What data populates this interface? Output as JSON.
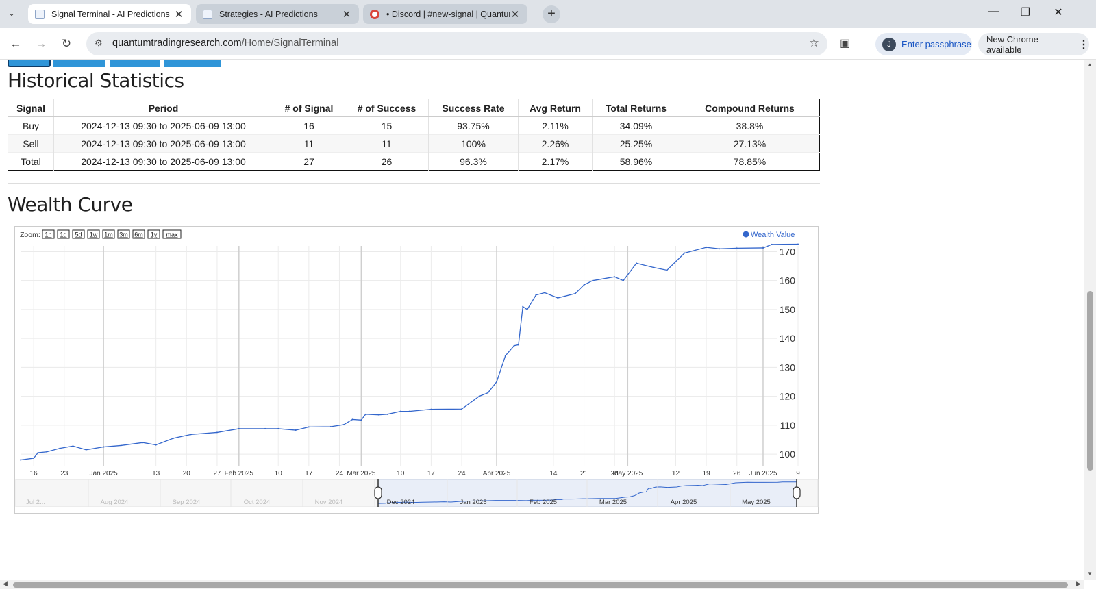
{
  "browser": {
    "tabs": [
      {
        "title": "Signal Terminal - AI Predictions",
        "active": true
      },
      {
        "title": "Strategies - AI Predictions",
        "active": false
      },
      {
        "title": "• Discord | #new-signal | Quantum",
        "active": false
      }
    ],
    "url_host": "quantumtradingresearch.com",
    "url_path": "/Home/SignalTerminal",
    "profile_initial": "J",
    "passphrase_label": "Enter passphrase",
    "update_label": "New Chrome available"
  },
  "page": {
    "stats_title": "Historical Statistics",
    "wealth_title": "Wealth Curve",
    "table": {
      "headers": [
        "Signal",
        "Period",
        "# of Signal",
        "# of Success",
        "Success Rate",
        "Avg Return",
        "Total Returns",
        "Compound Returns"
      ],
      "rows": [
        [
          "Buy",
          "2024-12-13 09:30 to 2025-06-09 13:00",
          "16",
          "15",
          "93.75%",
          "2.11%",
          "34.09%",
          "38.8%"
        ],
        [
          "Sell",
          "2024-12-13 09:30 to 2025-06-09 13:00",
          "11",
          "11",
          "100%",
          "2.26%",
          "25.25%",
          "27.13%"
        ],
        [
          "Total",
          "2024-12-13 09:30 to 2025-06-09 13:00",
          "27",
          "26",
          "96.3%",
          "2.17%",
          "58.96%",
          "78.85%"
        ]
      ]
    }
  },
  "chart_data": {
    "type": "line",
    "zoom_label": "Zoom:",
    "zoom_options": [
      "1h",
      "1d",
      "5d",
      "1w",
      "1m",
      "3m",
      "6m",
      "1y",
      "max"
    ],
    "legend": "Wealth Value",
    "legend_position": "top-right",
    "series_color": "#3366cc",
    "ylim": [
      96,
      172
    ],
    "y_ticks": [
      100,
      110,
      120,
      130,
      140,
      150,
      160,
      170
    ],
    "x_start": "2024-12-13",
    "x_end": "2025-06-09",
    "x_ticks": [
      {
        "date": "2024-12-16",
        "label": "16"
      },
      {
        "date": "2024-12-23",
        "label": "23"
      },
      {
        "date": "2025-01-01",
        "label": "Jan 2025"
      },
      {
        "date": "2025-01-13",
        "label": "13"
      },
      {
        "date": "2025-01-20",
        "label": "20"
      },
      {
        "date": "2025-01-27",
        "label": "27"
      },
      {
        "date": "2025-02-01",
        "label": "Feb 2025"
      },
      {
        "date": "2025-02-10",
        "label": "10"
      },
      {
        "date": "2025-02-17",
        "label": "17"
      },
      {
        "date": "2025-02-24",
        "label": "24"
      },
      {
        "date": "2025-03-01",
        "label": "Mar 2025"
      },
      {
        "date": "2025-03-10",
        "label": "10"
      },
      {
        "date": "2025-03-17",
        "label": "17"
      },
      {
        "date": "2025-03-24",
        "label": "24"
      },
      {
        "date": "2025-04-01",
        "label": "Apr 2025"
      },
      {
        "date": "2025-04-14",
        "label": "14"
      },
      {
        "date": "2025-04-21",
        "label": "21"
      },
      {
        "date": "2025-04-28",
        "label": "28"
      },
      {
        "date": "2025-05-01",
        "label": "May 2025"
      },
      {
        "date": "2025-05-12",
        "label": "12"
      },
      {
        "date": "2025-05-19",
        "label": "19"
      },
      {
        "date": "2025-05-26",
        "label": "26"
      },
      {
        "date": "2025-06-01",
        "label": "Jun 2025"
      },
      {
        "date": "2025-06-09",
        "label": "9"
      }
    ],
    "points": [
      [
        "2024-12-13",
        98
      ],
      [
        "2024-12-16",
        98.6
      ],
      [
        "2024-12-17",
        100.5
      ],
      [
        "2024-12-19",
        100.8
      ],
      [
        "2024-12-22",
        102
      ],
      [
        "2024-12-25",
        102.8
      ],
      [
        "2024-12-28",
        101.5
      ],
      [
        "2025-01-01",
        102.5
      ],
      [
        "2025-01-05",
        103
      ],
      [
        "2025-01-10",
        104
      ],
      [
        "2025-01-13",
        103.2
      ],
      [
        "2025-01-17",
        105.5
      ],
      [
        "2025-01-21",
        106.8
      ],
      [
        "2025-01-27",
        107.5
      ],
      [
        "2025-02-01",
        108.8
      ],
      [
        "2025-02-07",
        108.8
      ],
      [
        "2025-02-10",
        108.8
      ],
      [
        "2025-02-14",
        108.3
      ],
      [
        "2025-02-17",
        109.4
      ],
      [
        "2025-02-22",
        109.5
      ],
      [
        "2025-02-25",
        110.2
      ],
      [
        "2025-02-27",
        112
      ],
      [
        "2025-03-01",
        111.8
      ],
      [
        "2025-03-02",
        113.8
      ],
      [
        "2025-03-05",
        113.6
      ],
      [
        "2025-03-07",
        113.8
      ],
      [
        "2025-03-10",
        114.8
      ],
      [
        "2025-03-12",
        114.8
      ],
      [
        "2025-03-17",
        115.5
      ],
      [
        "2025-03-24",
        115.6
      ],
      [
        "2025-03-28",
        120
      ],
      [
        "2025-03-30",
        121.2
      ],
      [
        "2025-04-01",
        125
      ],
      [
        "2025-04-03",
        134
      ],
      [
        "2025-04-05",
        137.5
      ],
      [
        "2025-04-06",
        137.8
      ],
      [
        "2025-04-07",
        151
      ],
      [
        "2025-04-08",
        150
      ],
      [
        "2025-04-10",
        155
      ],
      [
        "2025-04-12",
        155.8
      ],
      [
        "2025-04-15",
        154
      ],
      [
        "2025-04-19",
        155.5
      ],
      [
        "2025-04-21",
        158.5
      ],
      [
        "2025-04-23",
        160
      ],
      [
        "2025-04-28",
        161.3
      ],
      [
        "2025-04-30",
        160
      ],
      [
        "2025-05-03",
        166
      ],
      [
        "2025-05-07",
        164.5
      ],
      [
        "2025-05-10",
        163.6
      ],
      [
        "2025-05-14",
        169.5
      ],
      [
        "2025-05-19",
        171.5
      ],
      [
        "2025-05-22",
        171
      ],
      [
        "2025-05-26",
        171.2
      ],
      [
        "2025-06-01",
        171.3
      ],
      [
        "2025-06-03",
        172.5
      ],
      [
        "2025-06-09",
        172.6
      ]
    ],
    "navigator_labels": [
      "Jul 2...",
      "Aug 2024",
      "Sep 2024",
      "Oct 2024",
      "Nov 2024",
      "Dec 2024",
      "Jan 2025",
      "Feb 2025",
      "Mar 2025",
      "Apr 2025",
      "May 2025"
    ]
  }
}
